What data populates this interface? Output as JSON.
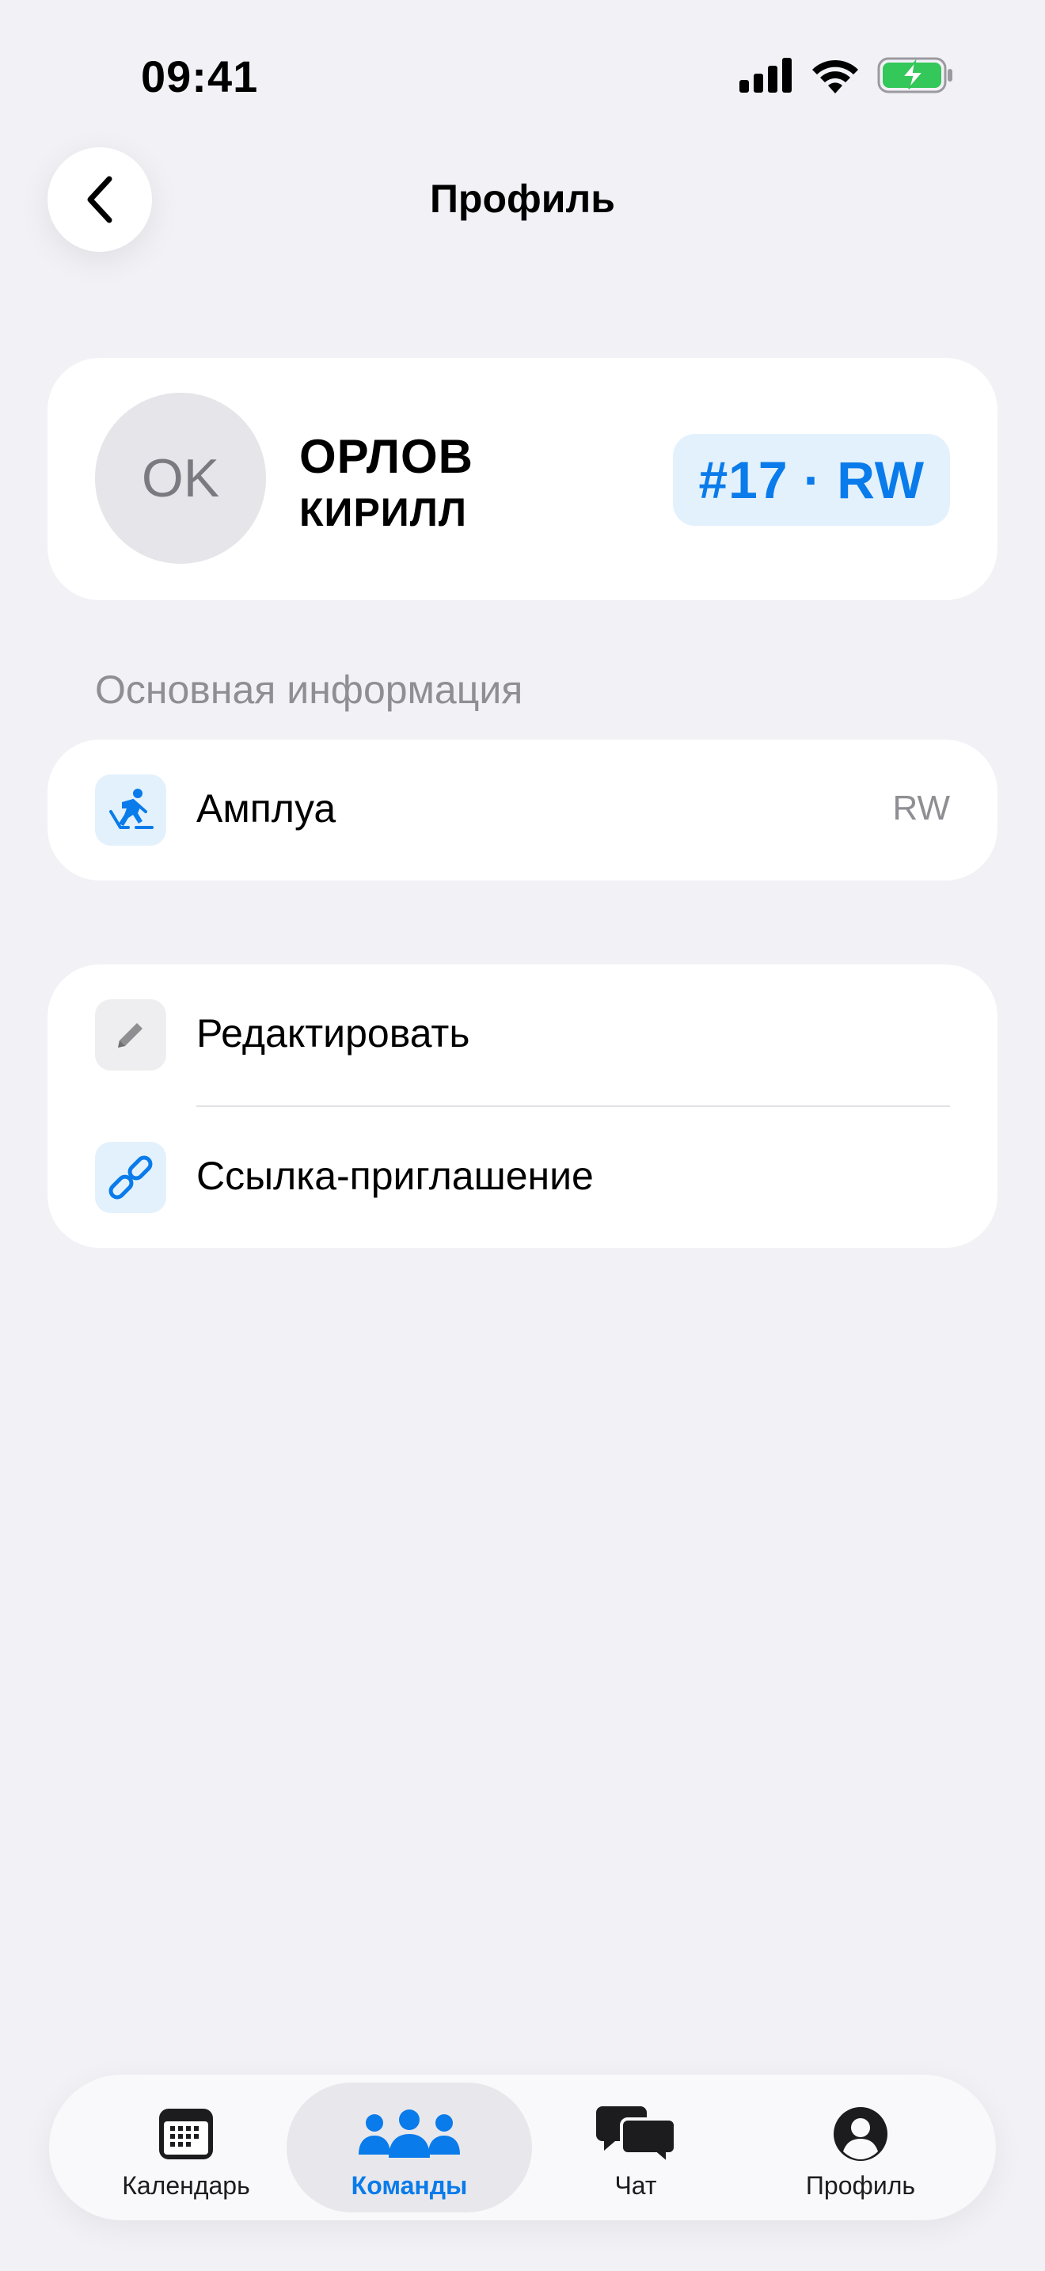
{
  "status_bar": {
    "time": "09:41"
  },
  "header": {
    "title": "Профиль"
  },
  "profile": {
    "initials": "OK",
    "surname": "ОРЛОВ",
    "first_name": "КИРИЛЛ",
    "badge": "#17 · RW"
  },
  "info_section": {
    "title": "Основная информация",
    "rows": [
      {
        "label": "Амплуа",
        "value": "RW",
        "icon": "hockey-player-icon"
      }
    ]
  },
  "actions": [
    {
      "label": "Редактировать",
      "icon": "pencil-icon"
    },
    {
      "label": "Ссылка-приглашение",
      "icon": "link-icon"
    }
  ],
  "tabbar": {
    "tabs": [
      {
        "label": "Календарь",
        "icon": "calendar-icon"
      },
      {
        "label": "Команды",
        "icon": "team-icon",
        "active": true
      },
      {
        "label": "Чат",
        "icon": "chat-icon"
      },
      {
        "label": "Профиль",
        "icon": "profile-icon"
      }
    ]
  },
  "colors": {
    "accent": "#0A7BEA",
    "badge_bg": "#E3F1FD",
    "background": "#F1F1F6",
    "battery": "#34C759"
  }
}
